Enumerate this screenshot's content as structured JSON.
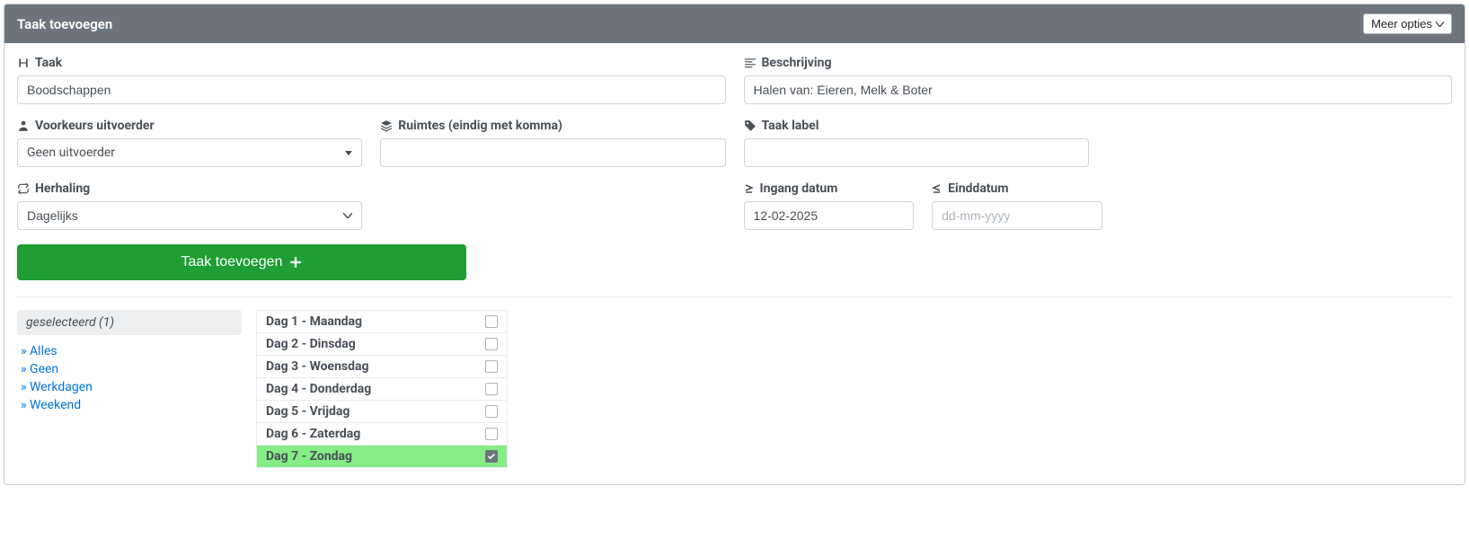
{
  "header": {
    "title": "Taak toevoegen",
    "more_options": "Meer opties"
  },
  "fields": {
    "task": {
      "label": "Taak",
      "value": "Boodschappen"
    },
    "description": {
      "label": "Beschrijving",
      "value": "Halen van: Eieren, Melk & Boter"
    },
    "executor": {
      "label": "Voorkeurs uitvoerder",
      "value": "Geen uitvoerder"
    },
    "rooms": {
      "label": "Ruimtes (eindig met komma)",
      "value": ""
    },
    "task_label": {
      "label": "Taak label",
      "value": ""
    },
    "repetition": {
      "label": "Herhaling",
      "value": "Dagelijks"
    },
    "start_date": {
      "label": "Ingang datum",
      "value": "12-02-2025"
    },
    "end_date": {
      "label": "Einddatum",
      "placeholder": "dd-mm-yyyy",
      "value": ""
    }
  },
  "submit_label": "Taak toevoegen",
  "filter": {
    "selected_label": "geselecteerd (1)",
    "links": [
      "Alles",
      "Geen",
      "Werkdagen",
      "Weekend"
    ]
  },
  "days": [
    {
      "label": "Dag 1 - Maandag",
      "checked": false
    },
    {
      "label": "Dag 2 - Dinsdag",
      "checked": false
    },
    {
      "label": "Dag 3 - Woensdag",
      "checked": false
    },
    {
      "label": "Dag 4 - Donderdag",
      "checked": false
    },
    {
      "label": "Dag 5 - Vrijdag",
      "checked": false
    },
    {
      "label": "Dag 6 - Zaterdag",
      "checked": false
    },
    {
      "label": "Dag 7 - Zondag",
      "checked": true
    }
  ]
}
